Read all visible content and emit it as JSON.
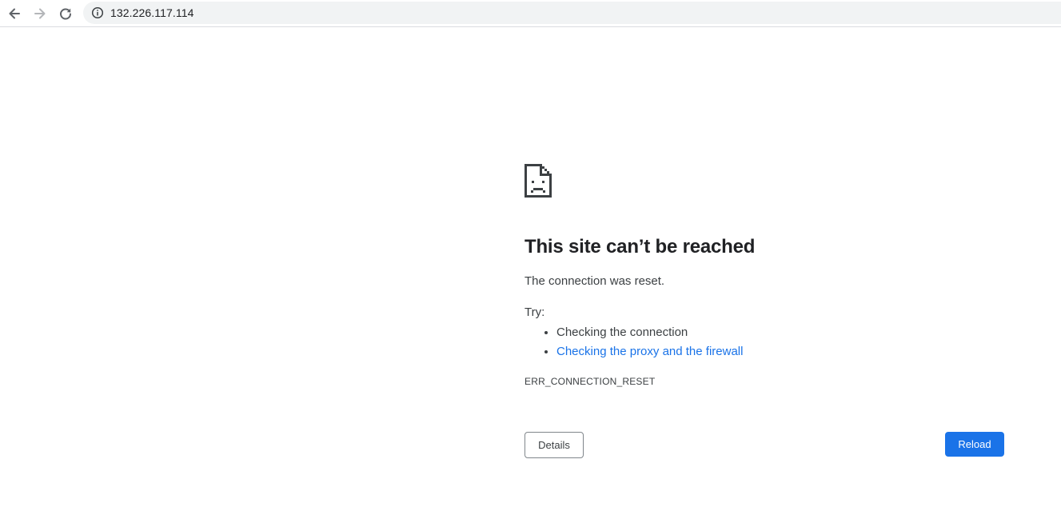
{
  "browser": {
    "back_icon": "arrow-left-icon",
    "forward_icon": "arrow-right-icon",
    "reload_icon": "refresh-icon",
    "site_info_icon": "info-icon",
    "url": "132.226.117.114"
  },
  "error_page": {
    "icon": "sad-page-icon",
    "title": "This site can’t be reached",
    "description": "The connection was reset.",
    "try_label": "Try:",
    "suggestions": [
      {
        "text": "Checking the connection",
        "is_link": false
      },
      {
        "text": "Checking the proxy and the firewall",
        "is_link": true
      }
    ],
    "error_code": "ERR_CONNECTION_RESET",
    "details_button": "Details",
    "reload_button": "Reload"
  },
  "colors": {
    "accent": "#1a73e8",
    "omnibox_bg": "#f1f3f4",
    "text": "#202124",
    "secondary_text": "#3c4043"
  }
}
